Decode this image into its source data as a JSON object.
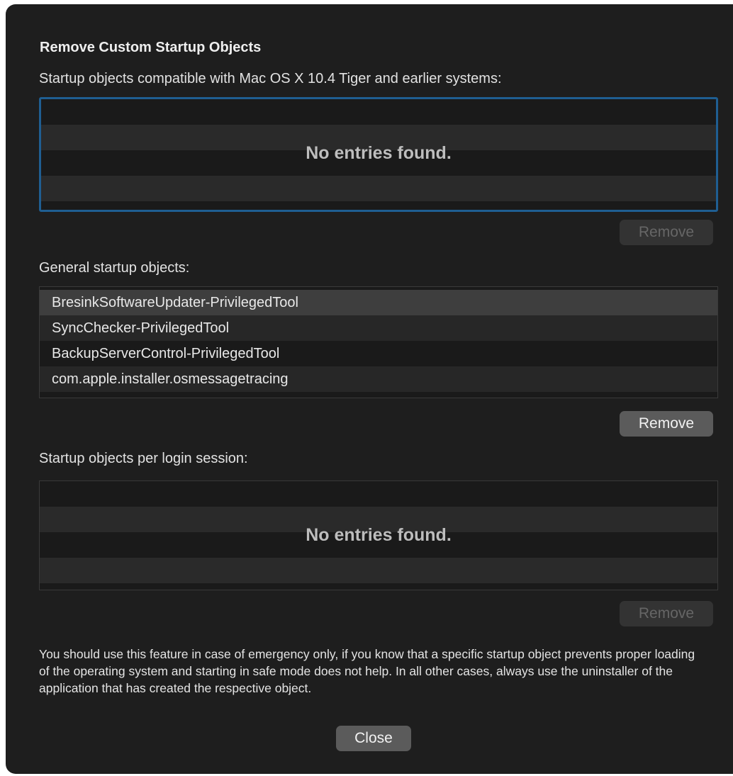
{
  "dialog": {
    "title": "Remove Custom Startup Objects",
    "sections": {
      "legacy": {
        "label": "Startup objects compatible with Mac OS X 10.4 Tiger and earlier systems:",
        "empty_text": "No entries found.",
        "remove_label": "Remove",
        "remove_enabled": false
      },
      "general": {
        "label": "General startup objects:",
        "items": [
          "BresinkSoftwareUpdater-PrivilegedTool",
          "SyncChecker-PrivilegedTool",
          "BackupServerControl-PrivilegedTool",
          "com.apple.installer.osmessagetracing"
        ],
        "selected_item": "BresinkSoftwareUpdater-PrivilegedTool",
        "remove_label": "Remove",
        "remove_enabled": true
      },
      "login": {
        "label": "Startup objects per login session:",
        "empty_text": "No entries found.",
        "remove_label": "Remove",
        "remove_enabled": false
      }
    },
    "note": "You should use this feature in case of emergency only, if you know that a specific startup object prevents proper loading of the operating system and starting in safe mode does not help. In all other cases, always use the uninstaller of the application that has created the respective object.",
    "close_label": "Close"
  },
  "colors": {
    "background": "#1e1e1e",
    "focus_ring": "#1f5e92",
    "button_enabled": "#5b5b5b",
    "button_disabled": "#333333"
  }
}
